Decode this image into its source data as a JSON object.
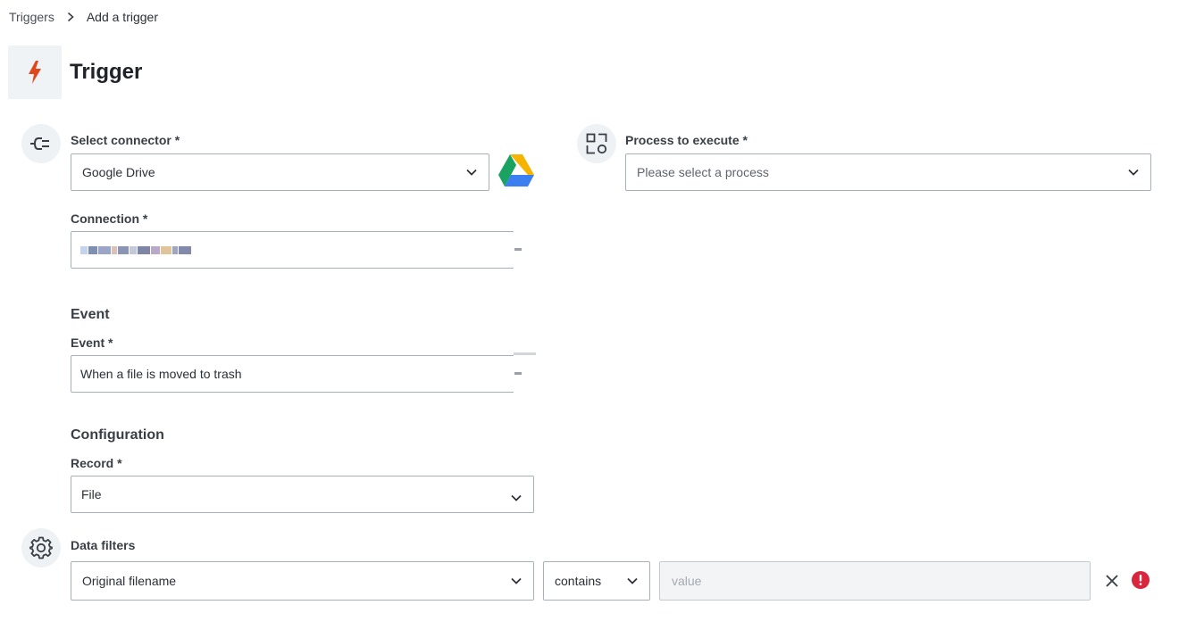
{
  "breadcrumb": {
    "parent": "Triggers",
    "current": "Add a trigger"
  },
  "header": {
    "title": "Trigger",
    "icon": "lightning-bolt-icon",
    "accent_color": "#e2461d"
  },
  "connector": {
    "label": "Select connector *",
    "value": "Google Drive",
    "logo": "google-drive-logo"
  },
  "process": {
    "label": "Process to execute *",
    "placeholder": "Please select a process"
  },
  "connection": {
    "label": "Connection *"
  },
  "event_section": {
    "title": "Event",
    "label": "Event *",
    "value": "When a file is moved to trash"
  },
  "configuration": {
    "title": "Configuration",
    "record_label": "Record *",
    "record_value": "File"
  },
  "data_filters": {
    "label": "Data filters",
    "field_value": "Original filename",
    "operator_value": "contains",
    "value_placeholder": "value",
    "error_color": "#d7263d"
  }
}
